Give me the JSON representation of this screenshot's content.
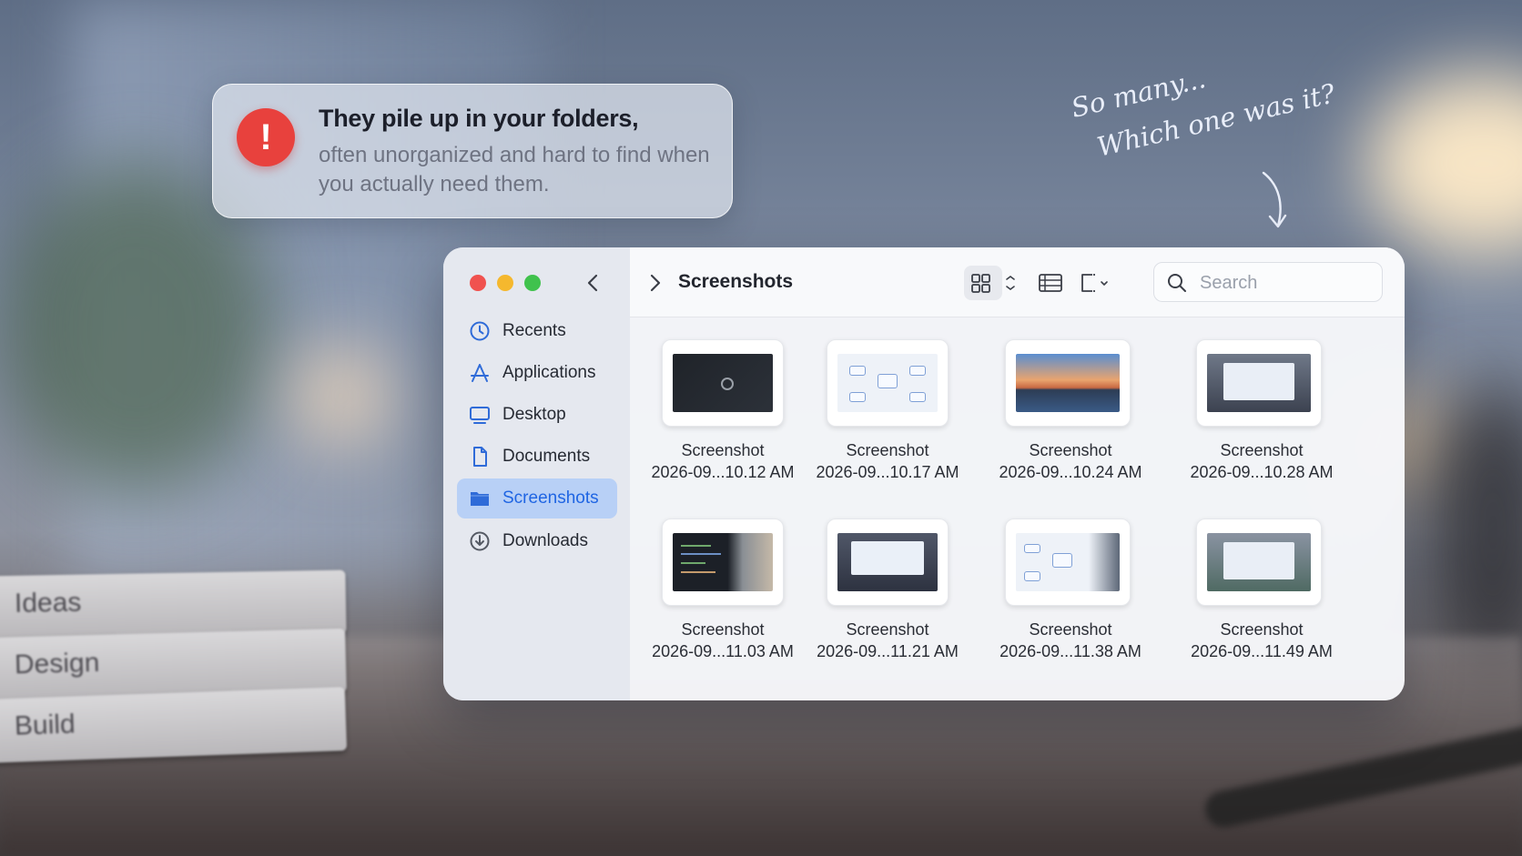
{
  "alert": {
    "icon": "exclamation-icon",
    "icon_glyph": "!",
    "title": "They pile up in your folders,",
    "body": "often unorganized and hard to find when you actually need them."
  },
  "note": {
    "line1": "So many...",
    "line2": "Which one was it?"
  },
  "books": [
    "Ideas",
    "Design",
    "Build"
  ],
  "finder": {
    "current_folder": "Screenshots",
    "search_placeholder": "Search",
    "sidebar": [
      {
        "label": "Recents",
        "icon": "clock-icon"
      },
      {
        "label": "Applications",
        "icon": "applications-icon"
      },
      {
        "label": "Desktop",
        "icon": "desktop-icon"
      },
      {
        "label": "Documents",
        "icon": "document-icon"
      },
      {
        "label": "Screenshots",
        "icon": "folder-icon",
        "active": true
      },
      {
        "label": "Downloads",
        "icon": "download-icon"
      }
    ],
    "files": [
      {
        "line1": "Screenshot",
        "line2": "2026-09...10.12 AM"
      },
      {
        "line1": "Screenshot",
        "line2": "2026-09...10.17 AM"
      },
      {
        "line1": "Screenshot",
        "line2": "2026-09...10.24 AM"
      },
      {
        "line1": "Screenshot",
        "line2": "2026-09...10.28 AM"
      },
      {
        "line1": "Screenshot",
        "line2": "2026-09...11.03 AM"
      },
      {
        "line1": "Screenshot",
        "line2": "2026-09...11.21 AM"
      },
      {
        "line1": "Screenshot",
        "line2": "2026-09...11.38 AM"
      },
      {
        "line1": "Screenshot",
        "line2": "2026-09...11.49 AM"
      }
    ]
  },
  "colors": {
    "accent": "#1f65e3",
    "sidebar_active": "#b8d0f6",
    "alert_red": "#e8413d",
    "traffic_red": "#f0524f",
    "traffic_yellow": "#f5b82e",
    "traffic_green": "#40c24d"
  }
}
